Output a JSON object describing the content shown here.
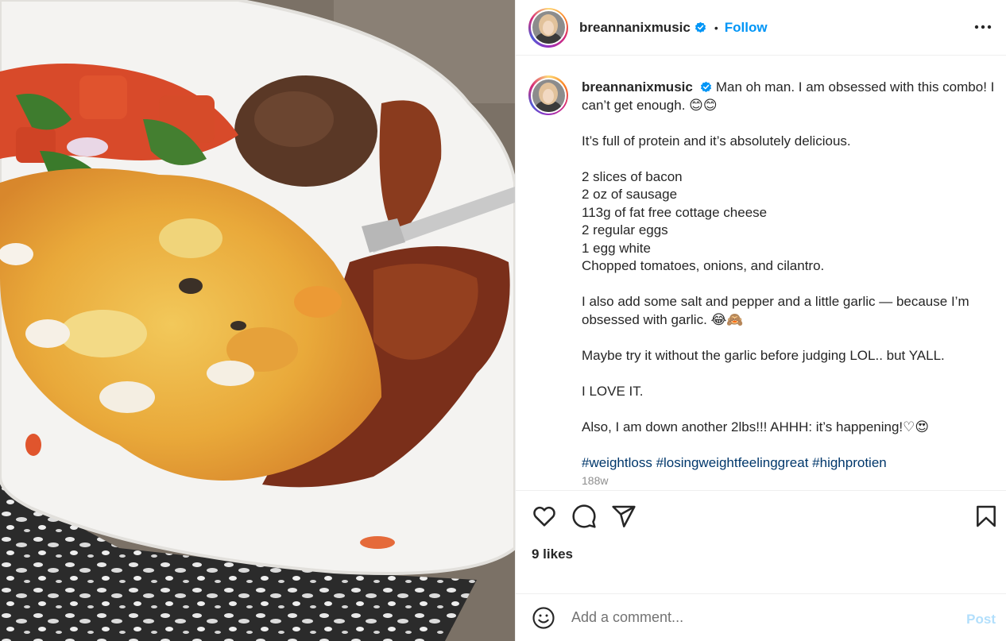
{
  "post": {
    "username": "breannanixmusic",
    "verified": true,
    "follow_label": "Follow",
    "separator": "•",
    "more_icon": "more-horizontal-icon"
  },
  "caption": {
    "username": "breannanixmusic",
    "intro": "Man oh man. I am obsessed with this combo! I can’t get enough. 😊😊",
    "line_protein": "It’s full of protein and it’s absolutely delicious.",
    "ingredients": [
      "2 slices of bacon",
      "2 oz of sausage",
      "113g of fat free cottage cheese",
      "2 regular eggs",
      "1 egg white",
      "Chopped tomatoes, onions, and cilantro."
    ],
    "garlic": "I also add some salt and pepper and a little garlic — because I’m obsessed with garlic. 😂🙈",
    "maybe": "Maybe try it without the garlic before judging LOL.. but YALL.",
    "love": "I LOVE IT.",
    "down": "Also, I am down another 2lbs!!! AHHH: it’s happening!♡😍",
    "hashtags": [
      "#weightloss",
      "#losingweightfeelinggreat",
      "#highprotien"
    ],
    "timestamp": "188w"
  },
  "actions": {
    "like_icon": "heart-icon",
    "comment_icon": "comment-icon",
    "share_icon": "send-icon",
    "save_icon": "bookmark-icon"
  },
  "likes": "9 likes",
  "comment": {
    "placeholder": "Add a comment...",
    "post_label": "Post",
    "emoji_icon": "smiley-icon"
  },
  "colors": {
    "link_blue": "#0095f6",
    "hashtag": "#00376b",
    "muted": "#8e8e8e",
    "post_disabled": "#b2dffc"
  }
}
